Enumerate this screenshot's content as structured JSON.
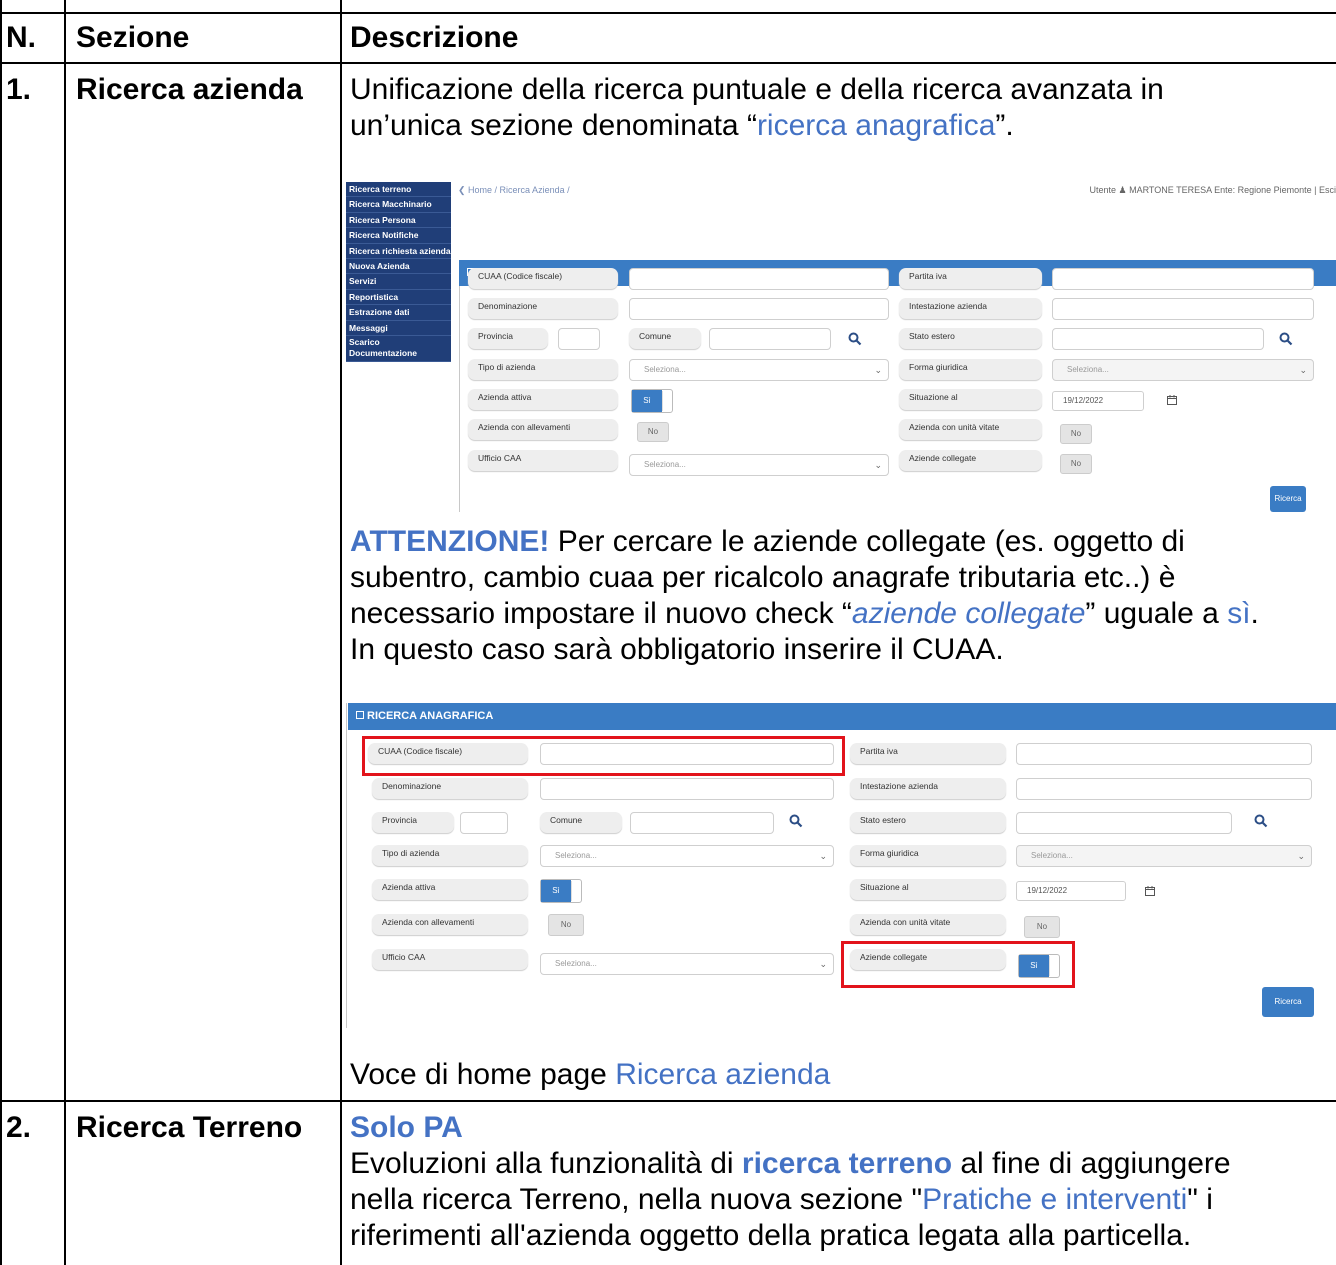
{
  "table": {
    "headers": {
      "num": "N.",
      "section": "Sezione",
      "description": "Descrizione"
    },
    "row1": {
      "num": "1.",
      "section": "Ricerca azienda",
      "desc_line1": "Unificazione della ricerca puntuale e della ricerca avanzata in",
      "desc_line2_a": "un’unica sezione denominata “",
      "desc_line2_link": "ricerca anagrafica",
      "desc_line2_b": "”.",
      "warn_label": "ATTENZIONE!",
      "warn_line1": " Per cercare le aziende collegate (es. oggetto di",
      "warn_line2": "subentro, cambio cuaa per ricalcolo anagrafe tributaria etc..) è",
      "warn_line3_a": "necessario impostare il nuovo check “",
      "warn_line3_ital": "aziende collegate",
      "warn_line3_b": "” uguale a ",
      "warn_line3_link": "sì",
      "warn_line3_c": ".",
      "warn_line4": "In questo caso sarà obbligatorio inserire il CUAA.",
      "footer_a": "Voce di home page ",
      "footer_link": "Ricerca azienda"
    },
    "row2": {
      "num": "2.",
      "section": "Ricerca Terreno",
      "solo_pa": "Solo PA",
      "line1_a": "Evoluzioni alla funzionalità di ",
      "line1_bold": "ricerca terreno",
      "line1_b": " al fine di aggiungere",
      "line2_a": "nella ricerca Terreno, nella nuova sezione \"",
      "line2_link": "Pratiche e interventi",
      "line2_b": "\" i",
      "line3": "riferimenti all'azienda oggetto della pratica legata alla particella."
    }
  },
  "app": {
    "menu": [
      "Ricerca terreno",
      "Ricerca Macchinario",
      "Ricerca Persona",
      "Ricerca Notifiche",
      "Ricerca richiesta azienda",
      "Nuova Azienda",
      "Servizi",
      "Reportistica",
      "Estrazione dati",
      "Messaggi",
      "Scarico Documentazione Tecnica"
    ],
    "breadcrumb": "❮ Home / Ricerca Azienda /",
    "user_info": "Utente ♟ MARTONE TERESA   Ente: Regione Piemonte | Esci",
    "panel_title": "RICERCA ANAGRAFICA",
    "labels": {
      "cuaa": "CUAA (Codice fiscale)",
      "partita_iva": "Partita iva",
      "denominazione": "Denominazione",
      "intestazione": "Intestazione azienda",
      "provincia": "Provincia",
      "comune": "Comune",
      "stato_estero": "Stato estero",
      "tipo_azienda": "Tipo di azienda",
      "forma_giuridica": "Forma giuridica",
      "azienda_attiva": "Azienda attiva",
      "situazione_al": "Situazione al",
      "allevamenti": "Azienda con allevamenti",
      "unita_vitate": "Azienda con unità vitate",
      "ufficio_caa": "Ufficio CAA",
      "aziende_collegate": "Aziende collegate"
    },
    "placeholder_select": "Seleziona...",
    "date_value": "19/12/2022",
    "toggle_si": "Sì",
    "toggle_no": "No",
    "search_button": "Ricerca",
    "accent_color": "#3a7cc4",
    "menu_color": "#203e78",
    "highlight_color": "#e2131b"
  }
}
